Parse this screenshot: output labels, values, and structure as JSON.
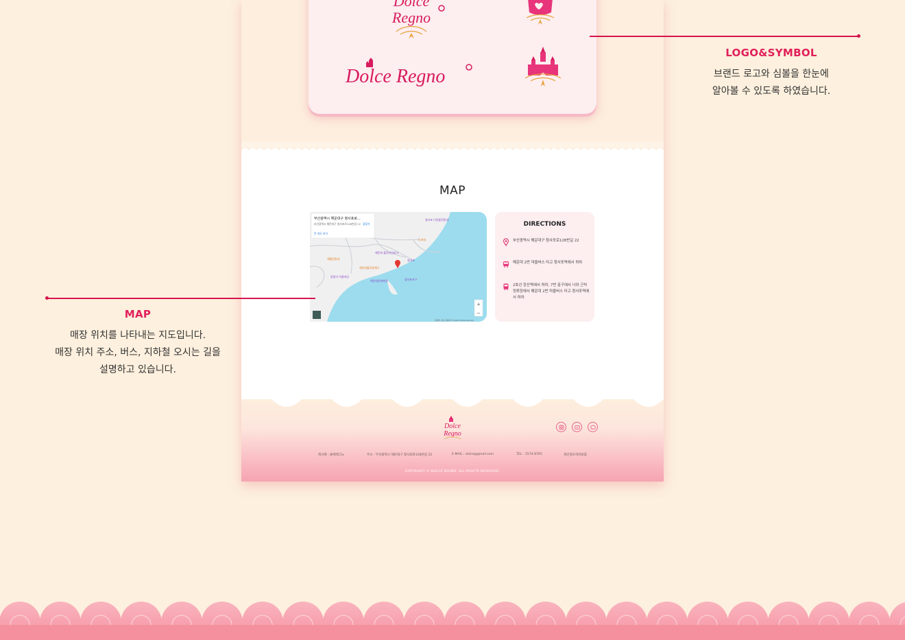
{
  "annotations": {
    "logo": {
      "title": "LOGO&SYMBOL",
      "lines": [
        "브랜드 로고와 심볼을 한눈에",
        "알아볼 수 있도록 하였습니다."
      ]
    },
    "map": {
      "title": "MAP",
      "lines": [
        "매장 위치를 나타내는 지도입니다.",
        "매장 위치 주소, 버스, 지하철 오시는 길을",
        "설명하고 있습니다."
      ]
    }
  },
  "logo_card": {
    "wordmark_stacked": [
      "Dolce",
      "Regno"
    ],
    "wordmark_inline": "Dolce Regno"
  },
  "map_section": {
    "title": "MAP",
    "map": {
      "info_title": "부산광역시 해운대구 청사포로...",
      "info_sub": "부산광역시 해운대구 청사포로128번길 22",
      "info_link": "큰 지도 보기",
      "directions_link": "길찾기",
      "labels": [
        "청사포 다릿돌전망대",
        "도파네",
        "해운대 블루라인파크",
        "해운대블루동해구",
        "청사포",
        "해월전망대",
        "청사포포구",
        "달맞이 어울마당",
        "해운대문화회관",
        "청사포등대"
      ],
      "zoom_in": "+",
      "zoom_out": "−",
      "attribution": "단축키  지도 데이터 ©2024 TMap Mobility"
    },
    "directions": {
      "title": "DIRECTIONS",
      "items": [
        {
          "icon": "location-pin-icon",
          "text": "부산광역시 해운대구 청사포로128번길 22"
        },
        {
          "icon": "bus-icon",
          "text": "해운대 2번 마을버스 타고 청사포역에서 하차"
        },
        {
          "icon": "subway-icon",
          "text": "2호선 장산역에서 하차, 7번 출구에서 나와 근처 정류장에서 해운대 2번 마을버스 타고 청사포역에서 하차"
        }
      ]
    }
  },
  "footer": {
    "logo": [
      "Dolce",
      "Regno"
    ],
    "social": [
      "instagram-icon",
      "youtube-icon",
      "talk-icon"
    ],
    "info": {
      "company": "회사명 : 돌체레그노",
      "address": "주소 : 부산광역시 해운대구 청사포로128번길 22",
      "email": "E-MAIL : dolce@gmail.com",
      "tel": "TEL : 1574-8765",
      "privacy": "개인정보처리방침"
    },
    "copyright": "COPYRIGHT © DOLCE REGNO. ALL RIGHTS RESERVED."
  },
  "colors": {
    "background": "#fdf0de",
    "accent": "#e0205a",
    "pink_light": "#fdeef0",
    "sea": "#9cdcee"
  }
}
